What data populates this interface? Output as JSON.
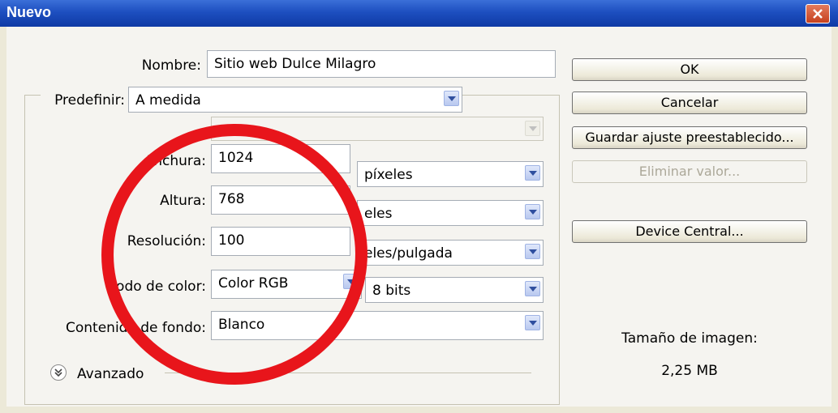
{
  "window": {
    "title": "Nuevo"
  },
  "form": {
    "nombre_label": "Nombre:",
    "nombre_value": "Sitio web Dulce Milagro",
    "predefinir_label": "Predefinir:",
    "predefinir_value": "A medida",
    "tamano_value": "",
    "anchura_label": "Anchura:",
    "anchura_value": "1024",
    "anchura_unit": "píxeles",
    "altura_label": "Altura:",
    "altura_value": "768",
    "altura_unit": "eles",
    "resolucion_label": "Resolución:",
    "resolucion_value": "100",
    "resolucion_unit": "eles/pulgada",
    "modo_label": "odo de color:",
    "modo_value": "Color RGB",
    "modo_bits": "8 bits",
    "contenido_label": "Contenido de fondo:",
    "contenido_value": "Blanco",
    "avanzado_label": "Avanzado"
  },
  "buttons": {
    "ok": "OK",
    "cancelar": "Cancelar",
    "guardar": "Guardar ajuste preestablecido...",
    "eliminar": "Eliminar valor...",
    "device": "Device Central..."
  },
  "info": {
    "size_label": "Tamaño de imagen:",
    "size_value": "2,25 MB"
  },
  "colors": {
    "title_bar": "#1d4fc0",
    "annotation_circle": "#e8151b"
  }
}
